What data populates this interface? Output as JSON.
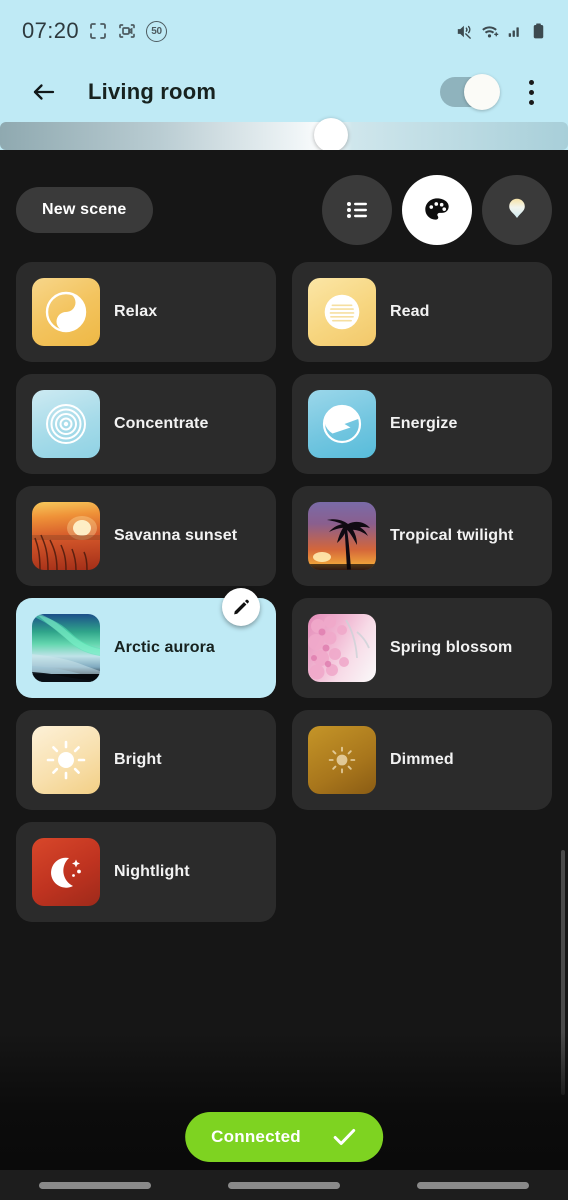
{
  "statusbar": {
    "time": "07:20",
    "crop_icon": "screenshot-crop-icon",
    "record_icon": "screen-record-icon",
    "speed_badge": "50",
    "mute_icon": "vibrate-mute-icon",
    "wifi_icon": "wifi-icon",
    "signal_icon": "cellular-signal-icon",
    "battery_icon": "battery-icon"
  },
  "appbar": {
    "back_icon": "back-arrow-icon",
    "title": "Living room",
    "power_toggle_state": "on",
    "menu_icon": "overflow-menu-icon"
  },
  "brightness": {
    "value": 58,
    "label": "brightness-slider"
  },
  "toolbar": {
    "new_scene_label": "New scene",
    "tabs": [
      {
        "name": "list-tab",
        "icon": "list-icon",
        "active": false
      },
      {
        "name": "palette-tab",
        "icon": "palette-icon",
        "active": true
      },
      {
        "name": "bulb-tab",
        "icon": "bulb-icon",
        "active": false
      }
    ]
  },
  "scenes": [
    {
      "label": "Relax",
      "thumb": "relax-gradient-icon",
      "art": "t-relax",
      "selected": false
    },
    {
      "label": "Read",
      "thumb": "read-lines-icon",
      "art": "t-read",
      "selected": false
    },
    {
      "label": "Concentrate",
      "thumb": "concentric-rings-icon",
      "art": "t-conc",
      "selected": false
    },
    {
      "label": "Energize",
      "thumb": "energize-bolt-icon",
      "art": "t-energ",
      "selected": false
    },
    {
      "label": "Savanna sunset",
      "thumb": "savanna-sunset-photo",
      "art": "t-savanna",
      "selected": false
    },
    {
      "label": "Tropical twilight",
      "thumb": "tropical-twilight-photo",
      "art": "t-tropical",
      "selected": false
    },
    {
      "label": "Arctic aurora",
      "thumb": "arctic-aurora-photo",
      "art": "t-aurora",
      "selected": true
    },
    {
      "label": "Spring blossom",
      "thumb": "spring-blossom-photo",
      "art": "t-spring",
      "selected": false
    },
    {
      "label": "Bright",
      "thumb": "sun-bright-icon",
      "art": "t-bright",
      "selected": false
    },
    {
      "label": "Dimmed",
      "thumb": "sun-dimmed-icon",
      "art": "t-dim",
      "selected": false
    },
    {
      "label": "Nightlight",
      "thumb": "moon-stars-icon",
      "art": "t-night",
      "selected": false
    }
  ],
  "edit_button": {
    "icon": "pencil-icon"
  },
  "status_pill": {
    "label": "Connected",
    "icon": "checkmark-icon",
    "color": "#7ed321"
  },
  "colors": {
    "header_bg": "#bfeaf5",
    "page_bg": "#161616",
    "card_bg": "#2b2b2b",
    "selected_card_bg": "#bfeaf5",
    "accent_green": "#7ed321"
  },
  "navbar": {
    "pills": [
      "nav-recents",
      "nav-home",
      "nav-back"
    ]
  }
}
